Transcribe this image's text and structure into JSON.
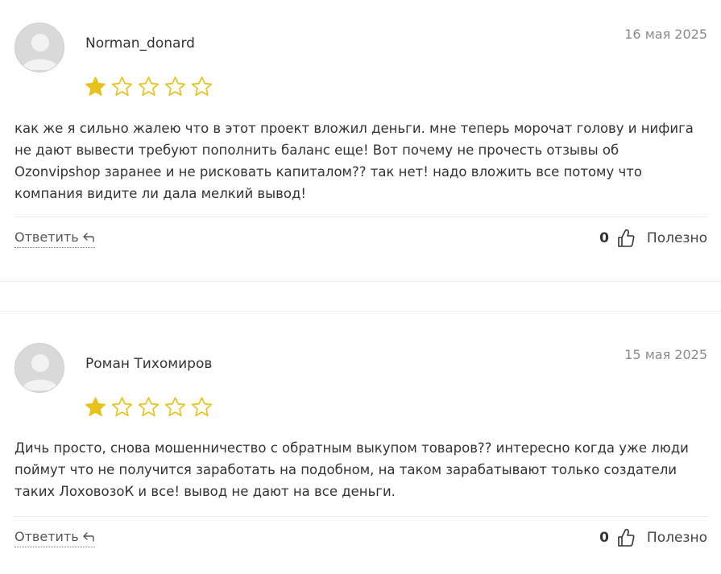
{
  "reviews": [
    {
      "author": "Norman_donard",
      "date": "16 мая 2025",
      "rating": 1,
      "text": "как же я сильно жалею что в этот проект вложил деньги. мне теперь морочат голову и нифига не дают вывести требуют пополнить баланс еще! Вот почему не прочесть отзывы об Ozonvipshop заранее и не рисковать капиталом?? так нет! надо вложить все потому что компания видите ли дала мелкий вывод!",
      "reply_label": "Ответить",
      "helpful_count": "0",
      "helpful_label": "Полезно"
    },
    {
      "author": "Роман Тихомиров",
      "date": "15 мая 2025",
      "rating": 1,
      "text": "Дичь просто, снова мошенничество с обратным выкупом товаров?? интересно когда уже люди поймут что не получится заработать на подобном, на таком зарабатывают только создатели таких ЛоховозоК и все! вывод не дают на все деньги.",
      "reply_label": "Ответить",
      "helpful_count": "0",
      "helpful_label": "Полезно"
    }
  ],
  "colors": {
    "star_filled": "#e8c21c",
    "star_outline": "#e8c21c",
    "avatar_bg": "#d9d9d9"
  }
}
